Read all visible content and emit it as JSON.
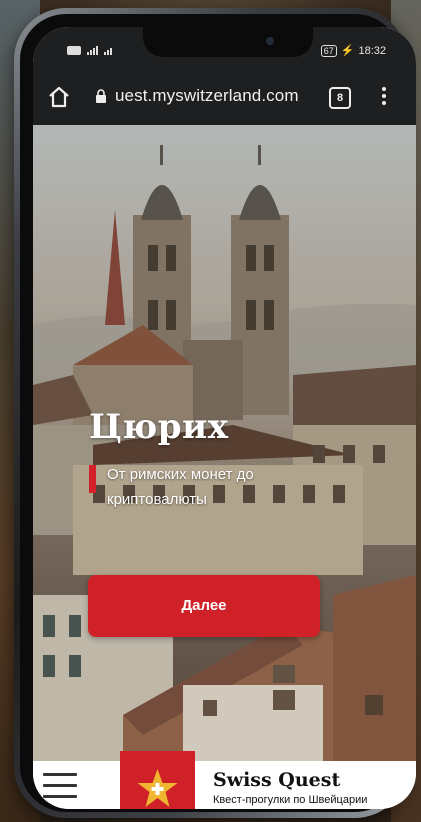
{
  "status_bar": {
    "time": "18:32",
    "battery": "67"
  },
  "browser": {
    "url": "uest.myswitzerland.com",
    "tab_count": "8"
  },
  "hero": {
    "title": "Цюрих",
    "subtitle": "От римских монет до криптовалюты",
    "button_label": "Далее"
  },
  "brand": {
    "name": "Swiss Quest",
    "tagline": "Квест-прогулки по Швейцарии"
  },
  "colors": {
    "accent": "#d02128",
    "dark": "#1e1f20"
  }
}
